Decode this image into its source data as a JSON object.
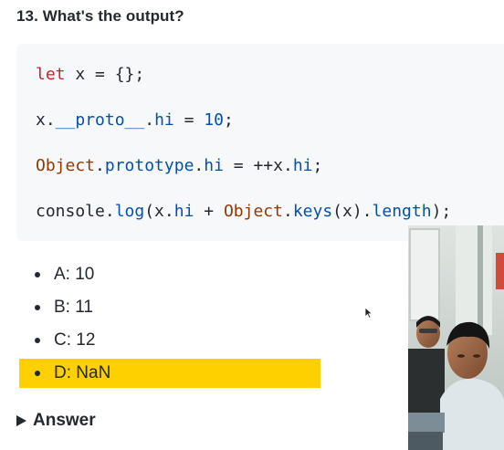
{
  "question": {
    "title": "13. What's the output?"
  },
  "code": {
    "line1": {
      "kw": "let",
      "rest": " x = {};"
    },
    "line2": {
      "a": "x.",
      "b": "__proto__",
      "c": ".",
      "d": "hi",
      "e": " = ",
      "f": "10",
      "g": ";"
    },
    "line3": {
      "a": "Object",
      "b": ".",
      "c": "prototype",
      "d": ".",
      "e": "hi",
      "f": " = ++x.",
      "g": "hi",
      "h": ";"
    },
    "line4": {
      "a": "console.",
      "b": "log",
      "c": "(x.",
      "d": "hi",
      "e": " + ",
      "f": "Object",
      "g": ".",
      "h": "keys",
      "i": "(x).",
      "j": "length",
      "k": ");"
    }
  },
  "options": [
    {
      "label": "A: 10",
      "highlighted": false
    },
    {
      "label": "B: 11",
      "highlighted": false
    },
    {
      "label": "C: 12",
      "highlighted": false
    },
    {
      "label": "D: NaN",
      "highlighted": true
    }
  ],
  "answer": {
    "label": "Answer"
  },
  "colors": {
    "highlight": "#ffd000",
    "keyword": "#cf222e",
    "object": "#953800",
    "property": "#0550ae",
    "code_background": "#f6f8fa"
  },
  "icons": {
    "answer_toggle": "triangle-right-icon",
    "pointer": "mouse-pointer-icon"
  }
}
